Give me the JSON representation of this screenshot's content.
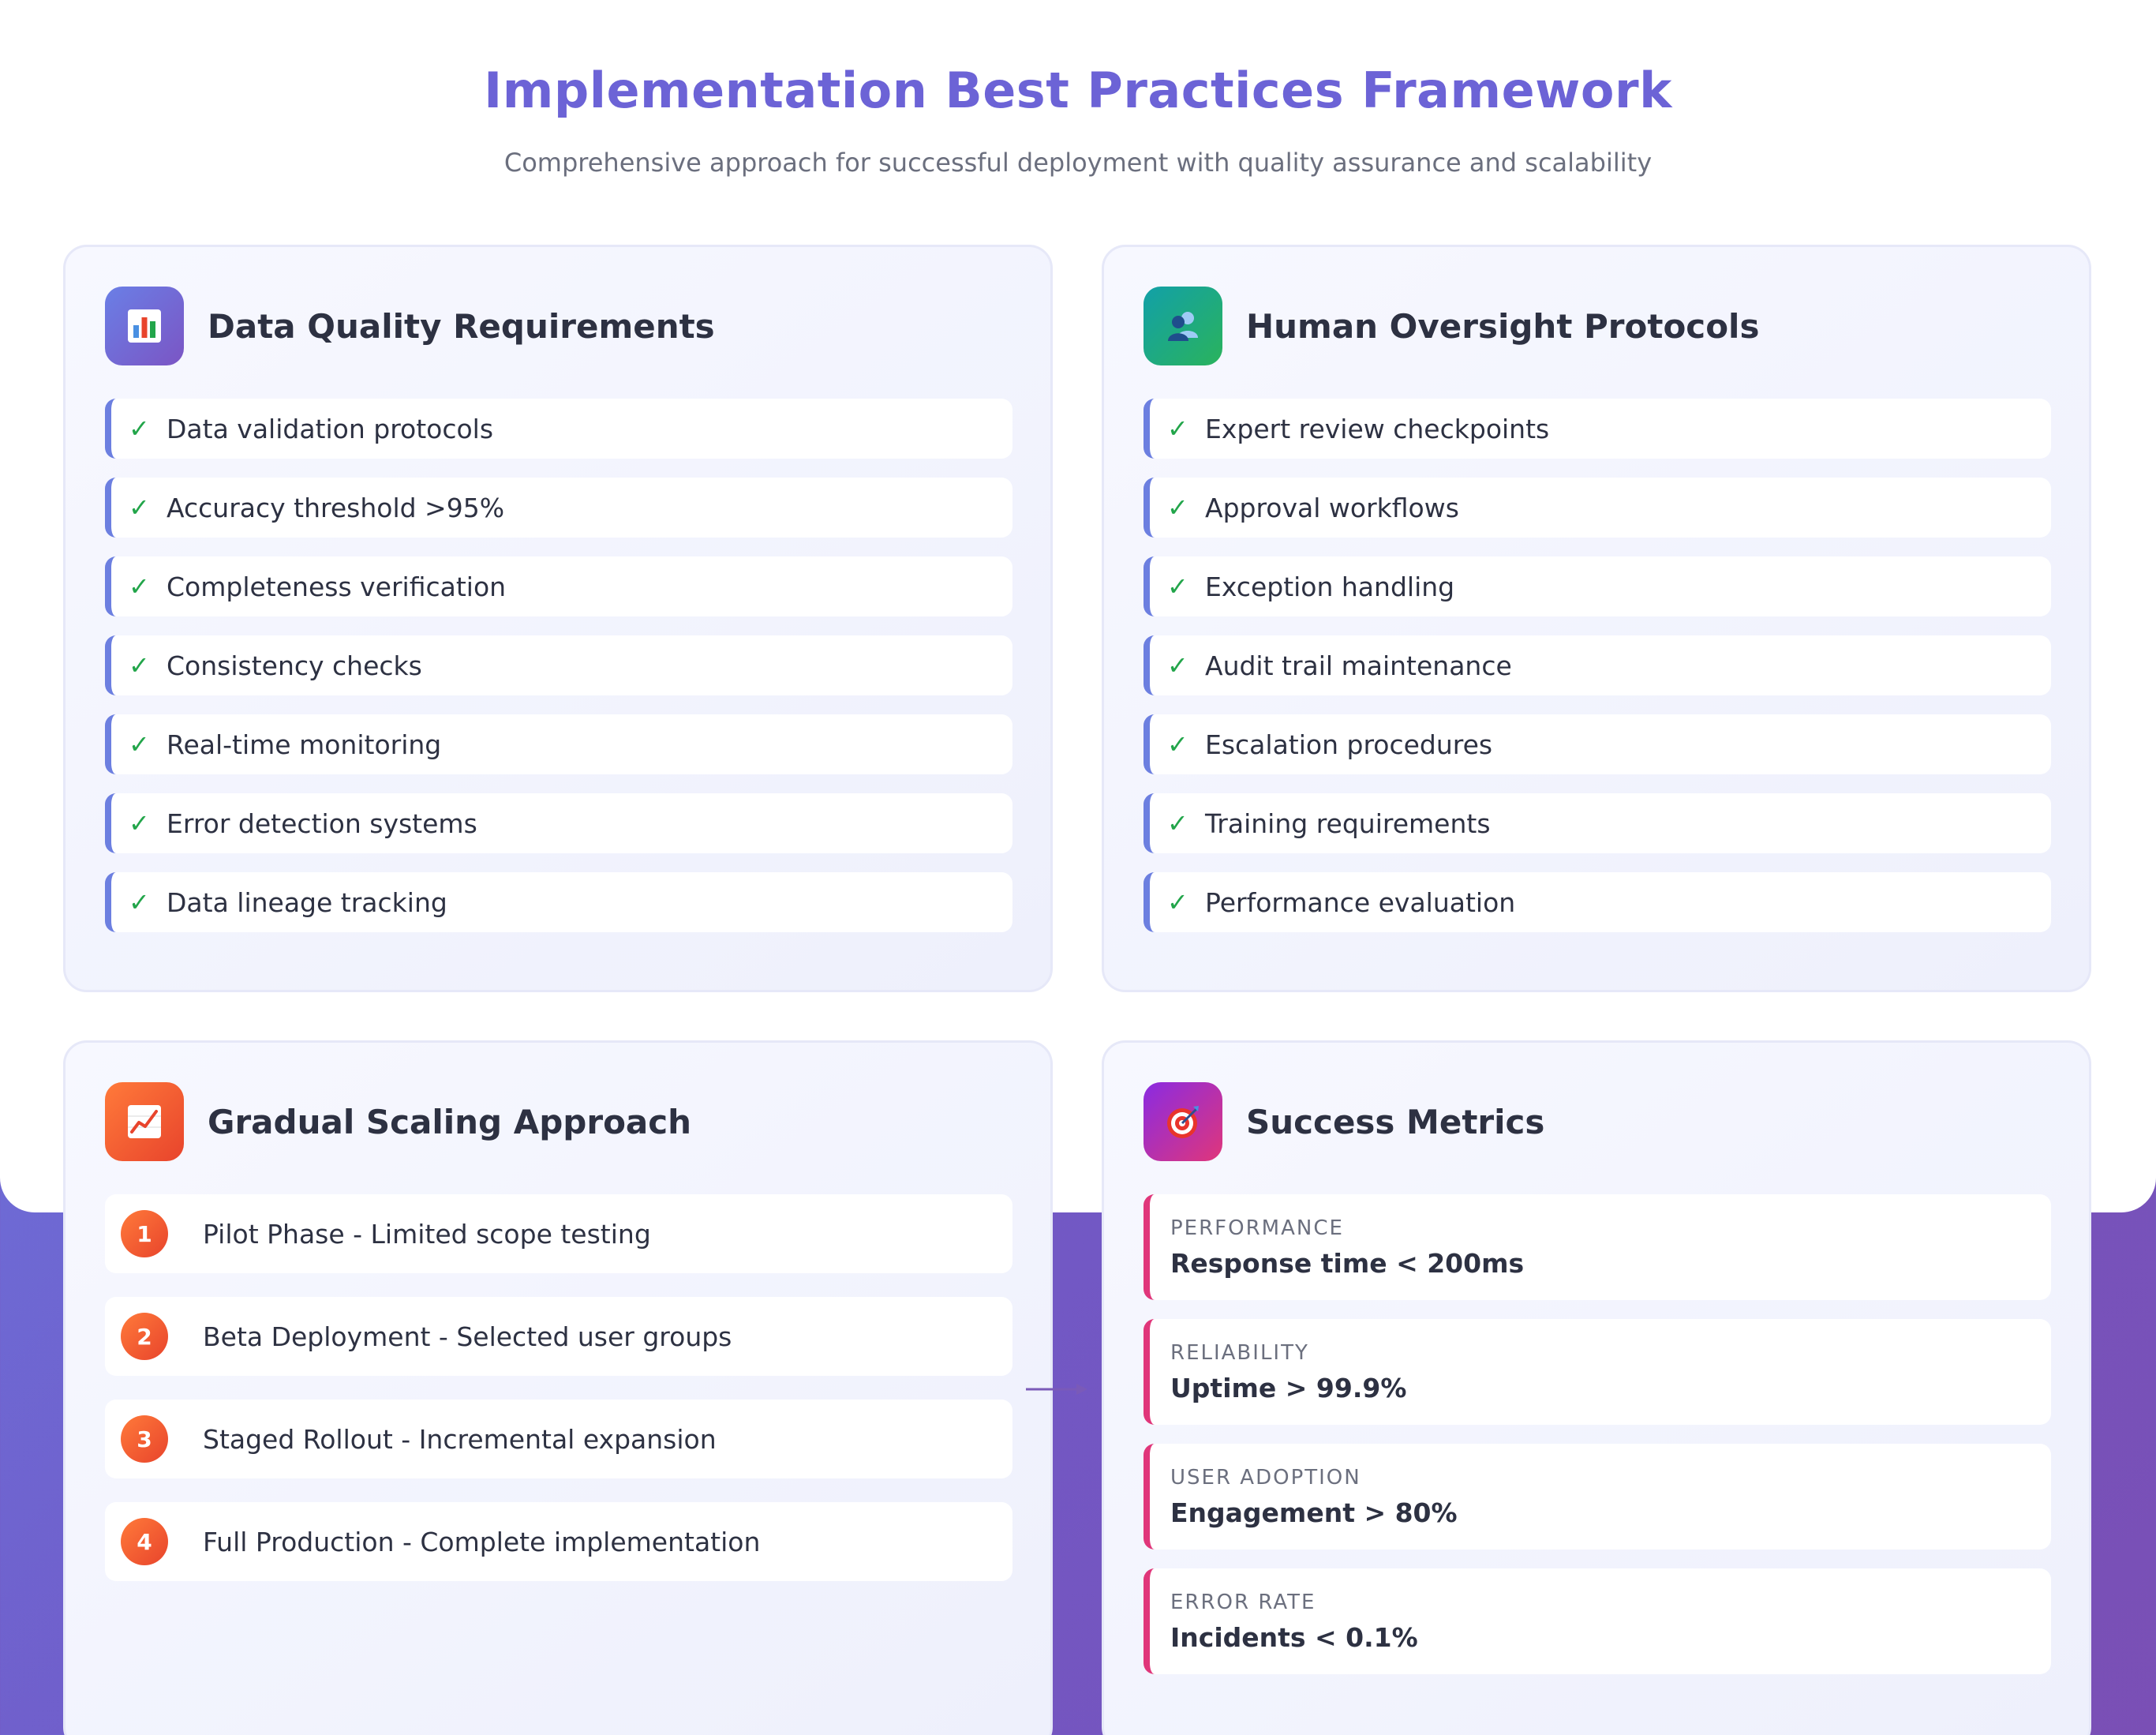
{
  "header": {
    "title": "Implementation Best Practices Framework",
    "subtitle": "Comprehensive approach for successful deployment with quality assurance and scalability"
  },
  "cards": {
    "data_quality": {
      "title": "Data Quality Requirements",
      "icon": "bar-chart-icon",
      "items": [
        "Data validation protocols",
        "Accuracy threshold >95%",
        "Completeness verification",
        "Consistency checks",
        "Real-time monitoring",
        "Error detection systems",
        "Data lineage tracking"
      ]
    },
    "human_oversight": {
      "title": "Human Oversight Protocols",
      "icon": "people-icon",
      "items": [
        "Expert review checkpoints",
        "Approval workflows",
        "Exception handling",
        "Audit trail maintenance",
        "Escalation procedures",
        "Training requirements",
        "Performance evaluation"
      ]
    },
    "gradual_scaling": {
      "title": "Gradual Scaling Approach",
      "icon": "trending-up-icon",
      "steps": [
        {
          "num": "1",
          "label": "Pilot Phase - Limited scope testing"
        },
        {
          "num": "2",
          "label": "Beta Deployment - Selected user groups"
        },
        {
          "num": "3",
          "label": "Staged Rollout - Incremental expansion"
        },
        {
          "num": "4",
          "label": "Full Production - Complete implementation"
        }
      ]
    },
    "success_metrics": {
      "title": "Success Metrics",
      "icon": "target-icon",
      "metrics": [
        {
          "label": "PERFORMANCE",
          "value": "Response time < 200ms"
        },
        {
          "label": "RELIABILITY",
          "value": "Uptime > 99.9%"
        },
        {
          "label": "USER ADOPTION",
          "value": "Engagement > 80%"
        },
        {
          "label": "ERROR RATE",
          "value": "Incidents < 0.1%"
        }
      ]
    }
  },
  "symbols": {
    "check": "✓"
  },
  "colors": {
    "title": "#6c63d6",
    "check": "#22a54a",
    "list_accent": "#6c7fe0",
    "metric_accent": "#e0367a",
    "step_badge": "#e8442c"
  }
}
